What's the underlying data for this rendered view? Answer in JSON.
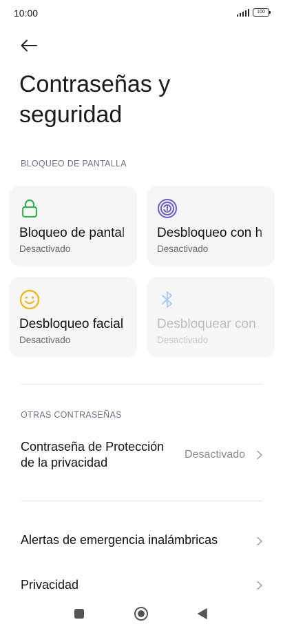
{
  "status_bar": {
    "time": "10:00",
    "battery": "100",
    "icons": [
      "signal-icon",
      "battery-icon"
    ]
  },
  "header": {
    "back_icon": "arrow-left-icon",
    "title": "Contraseñas y seguridad"
  },
  "screen_lock_section": {
    "header": "BLOQUEO DE PANTALLA",
    "tiles": [
      {
        "title": "Bloqueo de pantal",
        "status": "Desactivado",
        "icon": "lock-icon",
        "color": "#2eb84c",
        "enabled": true
      },
      {
        "title": "Desbloqueo con h",
        "status": "Desactivado",
        "icon": "fingerprint-icon",
        "color": "#6a5ad6",
        "enabled": true
      },
      {
        "title": "Desbloqueo facial",
        "status": "Desactivado",
        "icon": "face-icon",
        "color": "#f2b705",
        "enabled": true
      },
      {
        "title": "Desbloquear con",
        "status": "Desactivado",
        "icon": "bluetooth-icon",
        "color": "#a9cdf2",
        "enabled": false
      }
    ]
  },
  "other_passwords_section": {
    "header": "OTRAS CONTRASEÑAS",
    "privacy_password": {
      "label_line1": "Contraseña de Protección",
      "label_line2": "de la privacidad",
      "value": "Desactivado"
    }
  },
  "rows": {
    "emergency_alerts": "Alertas de emergencia inalámbricas",
    "privacy": "Privacidad"
  },
  "nav_bar": {
    "icons": [
      "recents-square-icon",
      "home-circle-icon",
      "back-triangle-icon"
    ]
  }
}
